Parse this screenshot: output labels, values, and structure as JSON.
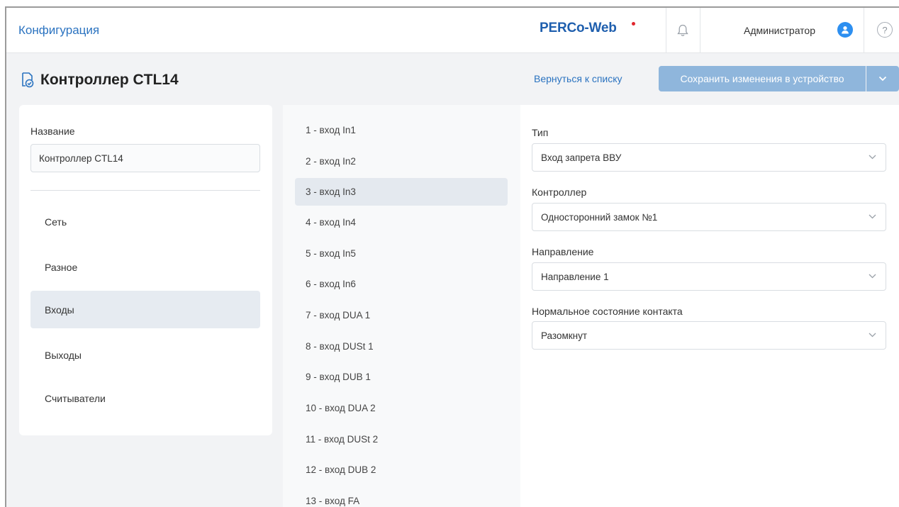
{
  "header": {
    "app_title": "Конфигурация",
    "logo": "PERCo-Web",
    "user_name": "Администратор",
    "help_glyph": "?",
    "icons": [
      "bell-icon",
      "user-avatar-icon",
      "help-icon"
    ]
  },
  "page": {
    "title": "Контроллер CTL14",
    "icon": "device-check-icon",
    "back_link": "Вернуться к списку",
    "save_button": "Сохранить изменения в устройство"
  },
  "left_panel": {
    "name_label": "Название",
    "name_value": "Контроллер CTL14",
    "nav": [
      {
        "label": "Сеть",
        "active": false
      },
      {
        "label": "Разное",
        "active": false
      },
      {
        "label": "Входы",
        "active": true
      },
      {
        "label": "Выходы",
        "active": false
      },
      {
        "label": "Считыватели",
        "active": false
      }
    ]
  },
  "inputs_list": [
    "1 - вход In1",
    "2 - вход In2",
    "3 - вход In3",
    "4 - вход In4",
    "5 - вход In5",
    "6 - вход In6",
    "7 - вход DUA 1",
    "8 - вход DUSt 1",
    "9 - вход DUB 1",
    "10 - вход DUA 2",
    "11 - вход DUSt 2",
    "12 - вход DUB 2",
    "13 - вход FA"
  ],
  "selected_input": "3 - вход In3",
  "form": {
    "type_label": "Тип",
    "type_value": "Вход запрета ВВУ",
    "controller_label": "Контроллер",
    "controller_value": "Односторонний замок №1",
    "direction_label": "Направление",
    "direction_value": "Направление 1",
    "contact_label": "Нормальное состояние контакта",
    "contact_value": "Разомкнут"
  },
  "colors": {
    "accent": "#2b73c0",
    "save_button": "#8fb6dc",
    "avatar": "#2d8ff0",
    "logo_dot": "#e0262d",
    "active_bg": "#e6ebf1"
  }
}
